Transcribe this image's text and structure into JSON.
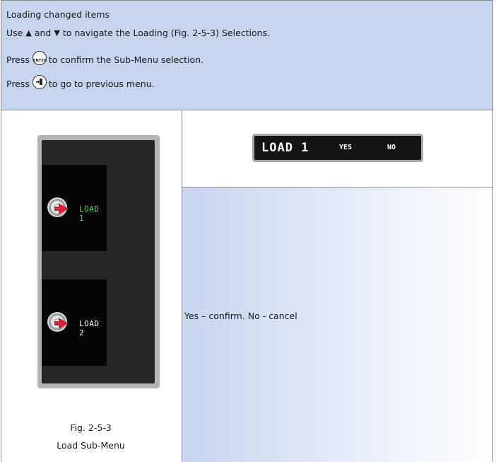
{
  "header": {
    "title": "Loading changed items",
    "nav_prefix": "Use",
    "up_symbol": "▲",
    "nav_and": "and",
    "down_symbol": "▼",
    "nav_suffix": "to navigate the Loading (Fig. 2-5-3) Selections.",
    "press1": "Press",
    "enter_label": "ENTER",
    "confirm_text": "to confirm the Sub-Menu selection.",
    "press2": "Press",
    "back_text": "to go to previous menu."
  },
  "figure": {
    "items": [
      {
        "label": "LOAD 1",
        "color": "#5dd15d"
      },
      {
        "label": "LOAD 2",
        "color": "#ffffff"
      }
    ],
    "caption_number": "Fig. 2-5-3",
    "caption_title": "Load Sub-Menu"
  },
  "display": {
    "main": "LOAD 1",
    "yes": "YES",
    "no": "NO"
  },
  "description": "Yes – confirm. No - cancel",
  "colors": {
    "header_bg": "#c8d3ec",
    "selected_item": "#5dd15d",
    "arrow": "#d3243b"
  },
  "icons": [
    "enter-button-icon",
    "exit-button-icon",
    "disc-icon",
    "arrow-icon"
  ]
}
